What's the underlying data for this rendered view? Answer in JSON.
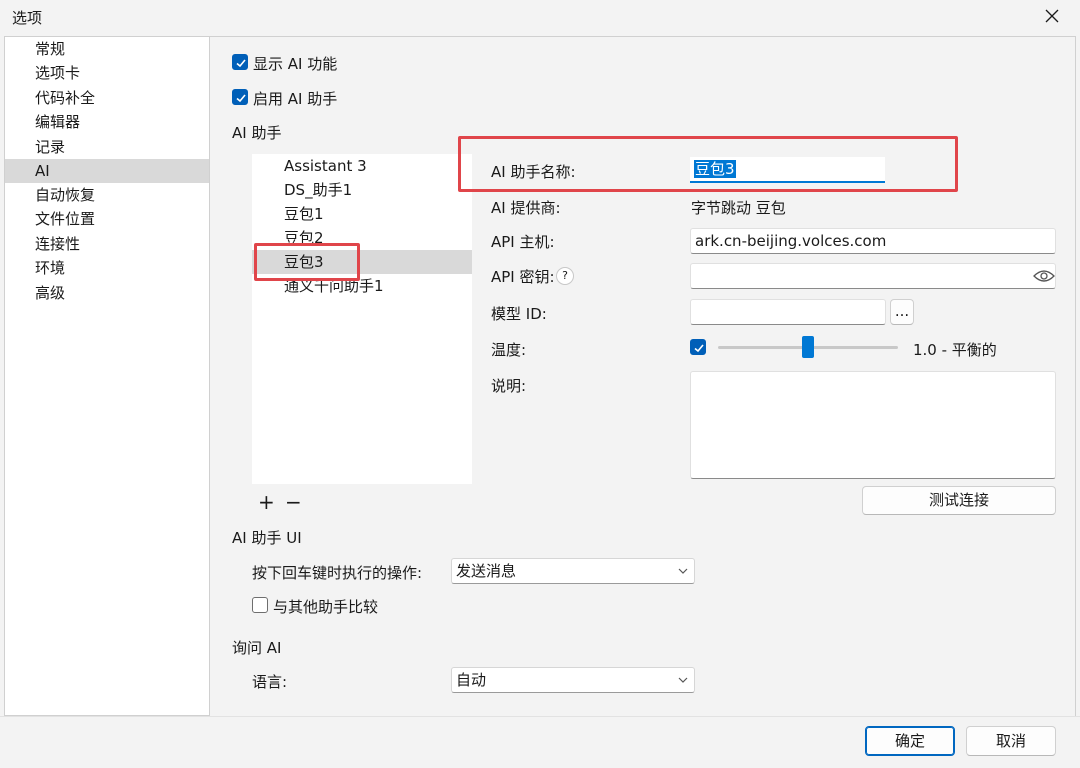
{
  "window": {
    "title": "选项"
  },
  "nav": {
    "items": [
      {
        "label": "常规"
      },
      {
        "label": "选项卡"
      },
      {
        "label": "代码补全"
      },
      {
        "label": "编辑器"
      },
      {
        "label": "记录"
      },
      {
        "label": "AI",
        "selected": true
      },
      {
        "label": "自动恢复"
      },
      {
        "label": "文件位置"
      },
      {
        "label": "连接性"
      },
      {
        "label": "环境"
      },
      {
        "label": "高级"
      }
    ]
  },
  "options": {
    "show_ai": {
      "label": "显示 AI 功能",
      "checked": true
    },
    "enable_assistant": {
      "label": "启用 AI 助手",
      "checked": true
    }
  },
  "assistant_section": {
    "heading": "AI 助手",
    "list": [
      "Assistant 3",
      "DS_助手1",
      "豆包1",
      "豆包2",
      "豆包3",
      "通义千问助手1"
    ],
    "selected_index": 4,
    "add_symbol": "+",
    "remove_symbol": "−"
  },
  "detail": {
    "name_label": "AI 助手名称:",
    "name_value": "豆包3",
    "provider_label": "AI 提供商:",
    "provider_value": "字节跳动 豆包",
    "host_label": "API 主机:",
    "host_value": "ark.cn-beijing.volces.com",
    "key_label": "API 密钥:",
    "key_help": "?",
    "key_value": "",
    "model_label": "模型 ID:",
    "model_value": "",
    "model_browse": "...",
    "temp_label": "温度:",
    "temp_checked": true,
    "temp_value": 0.5,
    "temp_text": "1.0 - 平衡的",
    "desc_label": "说明:",
    "desc_value": "",
    "test_button": "测试连接"
  },
  "ui_section": {
    "heading": "AI 助手 UI",
    "enter_label": "按下回车键时执行的操作:",
    "enter_value": "发送消息",
    "compare_label": "与其他助手比较",
    "compare_checked": false
  },
  "ask_section": {
    "heading": "询问 AI",
    "lang_label": "语言:",
    "lang_value": "自动"
  },
  "footer": {
    "ok": "确定",
    "cancel": "取消"
  },
  "colors": {
    "accent": "#005fb8",
    "highlight_box": "#e0454a"
  }
}
